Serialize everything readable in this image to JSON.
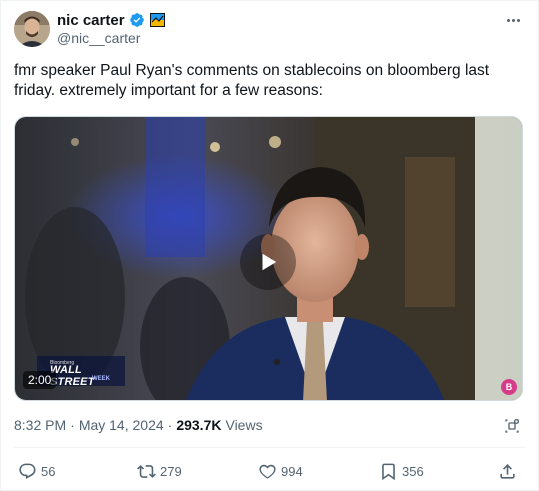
{
  "author": {
    "display_name": "nic carter",
    "handle": "@nic__carter",
    "avatar_icon": "profile-photo",
    "verified_icon": "verified-badge-icon",
    "flair_icon": "flag-emoji-icon"
  },
  "tweet": {
    "text": "fmr speaker Paul Ryan's comments on stablecoins on bloomberg last friday. extremely important for a few reasons:"
  },
  "media": {
    "type": "video",
    "duration": "2:00",
    "logo_top": "Bloomberg",
    "logo_main": "WALL STREET",
    "logo_sub": "WEEK",
    "corner_badge": "B"
  },
  "meta": {
    "time": "8:32 PM",
    "separator": "·",
    "date": "May 14, 2024",
    "views_count": "293.7K",
    "views_label": "Views"
  },
  "actions": {
    "replies": "56",
    "reposts": "279",
    "likes": "994",
    "bookmarks": "356"
  },
  "colors": {
    "text_primary": "#0f1419",
    "text_secondary": "#536471",
    "verified": "#1d9bf0",
    "border": "#eff3f4"
  }
}
